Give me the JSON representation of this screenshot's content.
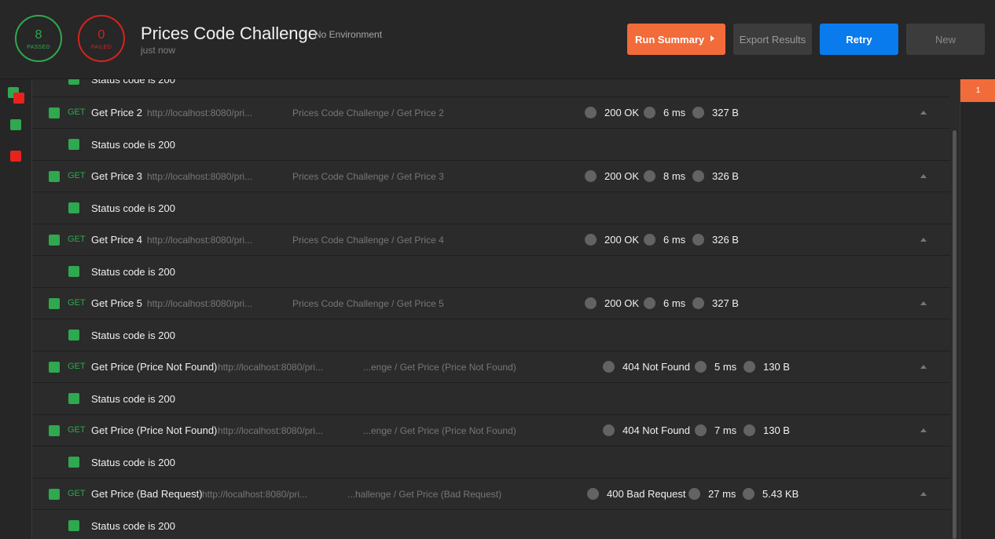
{
  "header": {
    "passed_count": "8",
    "passed_label": "PASSED",
    "failed_count": "0",
    "failed_label": "FAILED",
    "title": "Prices Code Challenge",
    "environment": "No Environment",
    "timestamp": "just now",
    "buttons": {
      "run_summary": "Run Summary",
      "export": "Export Results",
      "retry": "Retry",
      "new": "New"
    }
  },
  "sidebar": {
    "run_number": "1"
  },
  "top_test": "Status code is 200",
  "requests": [
    {
      "method": "GET",
      "name": "Get Price 2",
      "url": "http://localhost:8080/pri...",
      "path": "Prices Code Challenge / Get Price 2",
      "status": "200 OK",
      "time": "6 ms",
      "size": "327 B",
      "test": "Status code is 200"
    },
    {
      "method": "GET",
      "name": "Get Price 3",
      "url": "http://localhost:8080/pri...",
      "path": "Prices Code Challenge / Get Price 3",
      "status": "200 OK",
      "time": "8 ms",
      "size": "326 B",
      "test": "Status code is 200"
    },
    {
      "method": "GET",
      "name": "Get Price 4",
      "url": "http://localhost:8080/pri...",
      "path": "Prices Code Challenge / Get Price 4",
      "status": "200 OK",
      "time": "6 ms",
      "size": "326 B",
      "test": "Status code is 200"
    },
    {
      "method": "GET",
      "name": "Get Price 5",
      "url": "http://localhost:8080/pri...",
      "path": "Prices Code Challenge / Get Price 5",
      "status": "200 OK",
      "time": "6 ms",
      "size": "327 B",
      "test": "Status code is 200"
    },
    {
      "method": "GET",
      "name": "Get Price (Price Not Found)",
      "url": "http://localhost:8080/pri...",
      "path": "...enge / Get Price (Price Not Found)",
      "status": "404 Not Found",
      "time": "5 ms",
      "size": "130 B",
      "test": "Status code is 200"
    },
    {
      "method": "GET",
      "name": "Get Price (Price Not Found)",
      "url": "http://localhost:8080/pri...",
      "path": "...enge / Get Price (Price Not Found)",
      "status": "404 Not Found",
      "time": "7 ms",
      "size": "130 B",
      "test": "Status code is 200"
    },
    {
      "method": "GET",
      "name": "Get Price (Bad Request)",
      "url": "http://localhost:8080/pri...",
      "path": "...hallenge / Get Price (Bad Request)",
      "status": "400 Bad Request",
      "time": "27 ms",
      "size": "5.43 KB",
      "test": "Status code is 200"
    }
  ]
}
